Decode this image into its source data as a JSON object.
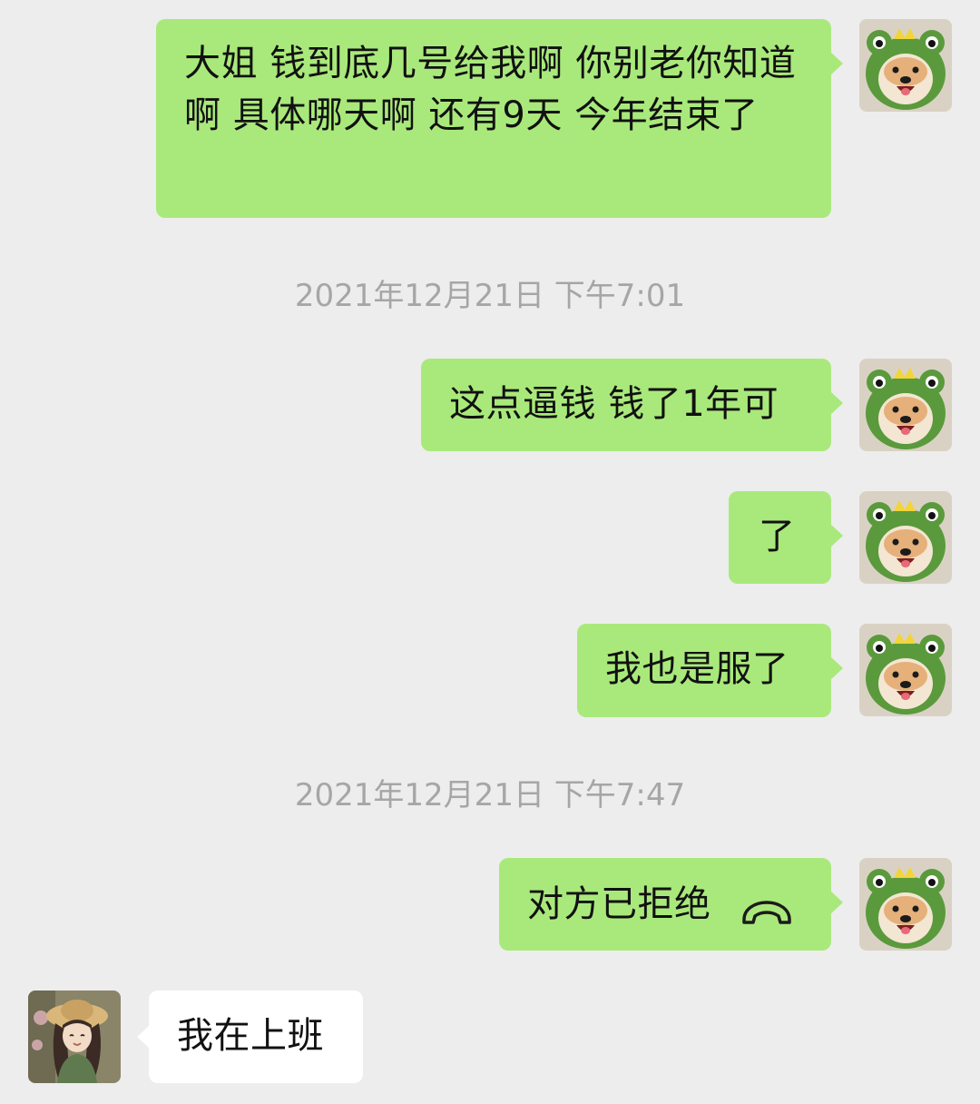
{
  "conversation": {
    "messages": [
      {
        "sender": "self",
        "text": "大姐 钱到底几号给我啊 你别老你知道啊 具体哪天啊 还有9天 今年结束了"
      },
      {
        "type": "timestamp",
        "text": "2021年12月21日 下午7:01"
      },
      {
        "sender": "self",
        "text": "这点逼钱 钱了1年可"
      },
      {
        "sender": "self",
        "text": "了"
      },
      {
        "sender": "self",
        "text": "我也是服了"
      },
      {
        "type": "timestamp",
        "text": "2021年12月21日 下午7:47"
      },
      {
        "sender": "self",
        "type": "call",
        "text": "对方已拒绝",
        "icon": "phone-hangup-icon"
      },
      {
        "sender": "peer",
        "text": "我在上班"
      }
    ]
  },
  "colors": {
    "background": "#ededed",
    "self_bubble": "#a9e97b",
    "peer_bubble": "#ffffff",
    "timestamp_text": "#a6a6a6"
  },
  "avatars": {
    "self": "shiba-dog-frog-hat-avatar",
    "peer": "girl-straw-hat-avatar"
  }
}
